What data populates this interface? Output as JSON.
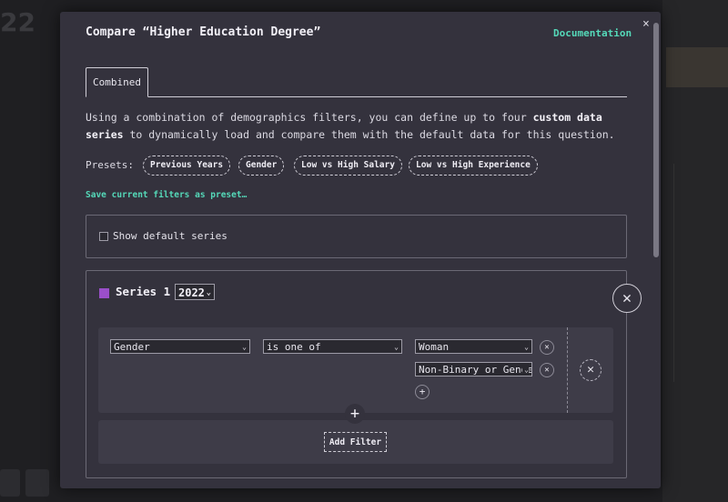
{
  "background": {
    "digits": "22"
  },
  "modal": {
    "title": "Compare “Higher Education Degree”",
    "documentation_link": "Documentation",
    "close_label": "×"
  },
  "tabs": [
    {
      "label": "Combined",
      "active": true
    }
  ],
  "intro": {
    "text_before": "Using a combination of demographics filters, you can define up to four ",
    "text_bold": "custom data series",
    "text_after": " to dynamically load and compare them with the default data for this question."
  },
  "presets": {
    "label": "Presets:",
    "items": [
      "Previous Years",
      "Gender",
      "Low vs High Salary",
      "Low vs High Experience"
    ],
    "save_link": "Save current filters as preset…"
  },
  "default_series": {
    "label": "Show default series",
    "checked": false
  },
  "series": [
    {
      "title": "Series 1",
      "color": "#9a4fc9",
      "year": "2022",
      "filters": [
        {
          "field": "Gender",
          "operator": "is one of",
          "values": [
            "Woman",
            "Non-Binary or Gender Non-Conforming"
          ]
        }
      ],
      "add_filter_label": "Add Filter"
    }
  ],
  "icons": {
    "close": "close-icon",
    "remove": "x-icon",
    "add": "plus-icon",
    "dropdown": "chevron-down-icon"
  },
  "colors": {
    "accent": "#55d9b9",
    "series1": "#9a4fc9",
    "modal_bg": "#34323d"
  }
}
